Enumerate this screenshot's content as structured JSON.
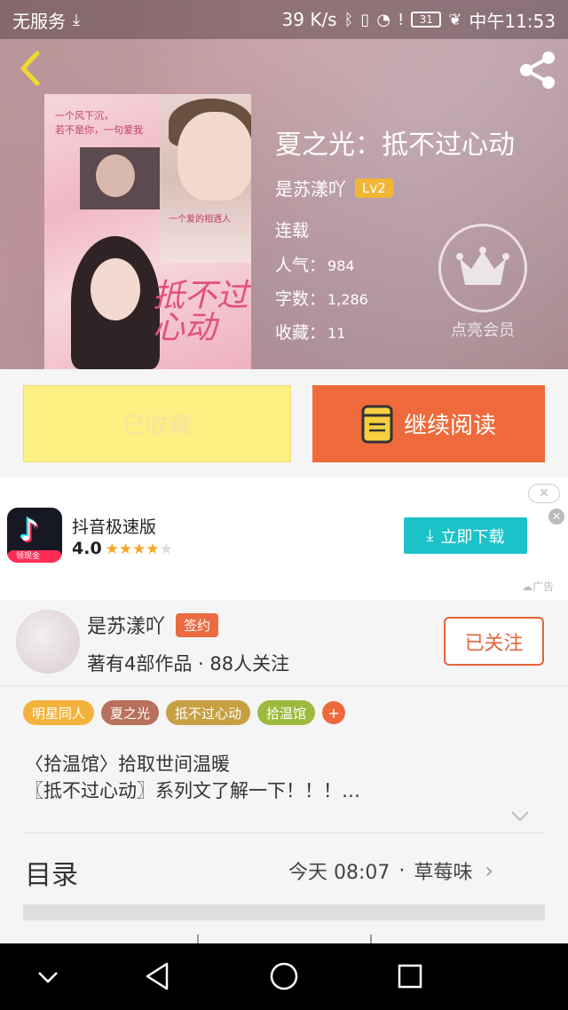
{
  "status_bar": {
    "carrier": "无服务",
    "speed": "39 K/s",
    "battery": "31",
    "time": "中午11:53"
  },
  "book": {
    "title": "夏之光：抵不过心动",
    "author": "是苏漾吖",
    "level": "Lv2",
    "status": "连载",
    "popularity_label": "人气：",
    "popularity": "984",
    "words_label": "字数：",
    "words": "1,286",
    "favorites_label": "收藏：",
    "favorites": "11",
    "cover_text_top": "一个风下沉，\n若不是你，一句爱我",
    "cover_text_mid": "一个爱的相遇人",
    "cover_title_art": "抵不过\n心动"
  },
  "vip": {
    "label": "点亮会员"
  },
  "actions": {
    "collected_label": "已收藏",
    "continue_label": "继续阅读"
  },
  "ad": {
    "app_name": "抖音极速版",
    "rating": "4.0",
    "stars": 4,
    "icon_tag": "领现金",
    "download_label": "立即下载",
    "ad_label": "广告",
    "colors": {
      "download": "#1bc2c8"
    }
  },
  "author_info": {
    "name": "是苏漾吖",
    "badge": "签约",
    "stats": "著有4部作品 · 88人关注",
    "follow_label": "已关注"
  },
  "tags": [
    {
      "label": "明星同人",
      "color": "#f3b23a"
    },
    {
      "label": "夏之光",
      "color": "#b7705a"
    },
    {
      "label": "抵不过心动",
      "color": "#c7a043"
    },
    {
      "label": "拾温馆",
      "color": "#9cbb3e"
    }
  ],
  "description": {
    "line1": "〈拾温馆〉拾取世间温暖",
    "line2": "〖抵不过心动〗系列文了解一下！！！…"
  },
  "toc": {
    "title": "目录",
    "update_time": "今天 08:07",
    "separator": "·",
    "latest_chapter": "草莓味"
  }
}
